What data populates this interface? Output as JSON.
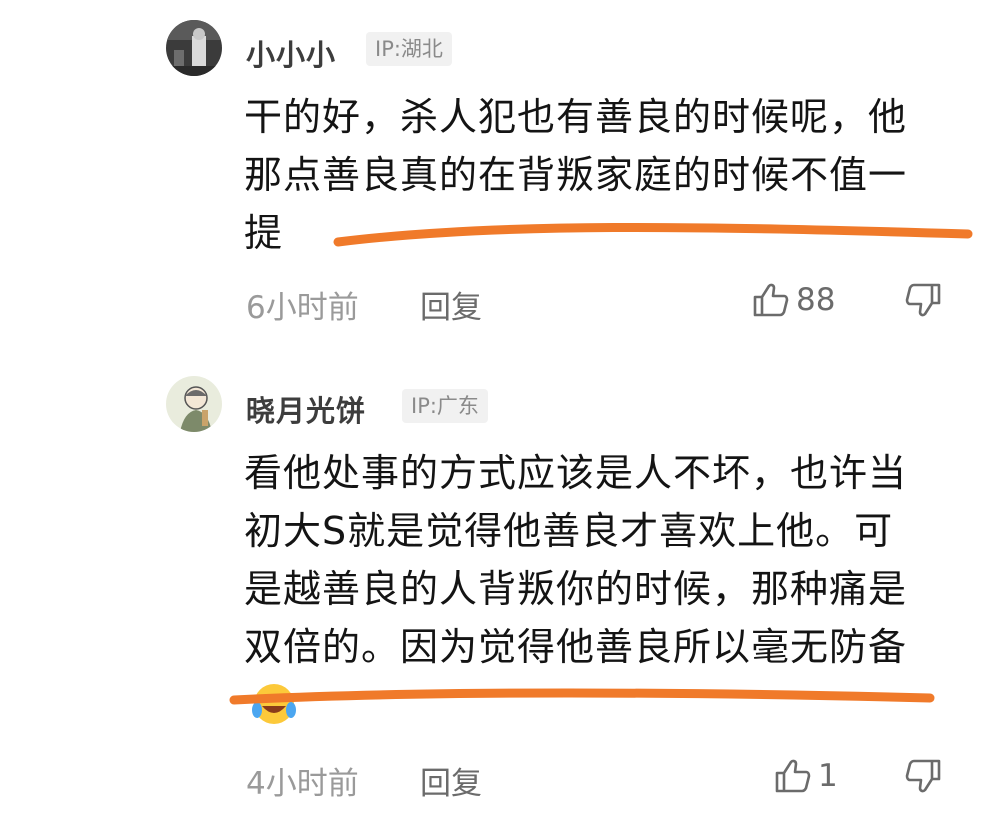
{
  "colors": {
    "highlight": "#f07a2a",
    "meta": "#9a9a9a",
    "badge_bg": "#f1f1f1"
  },
  "comments": [
    {
      "username": "小小小",
      "ip": "IP:湖北",
      "lines": [
        "干的好，杀人犯也有善良的时候呢，他",
        "那点善良真的在背叛家庭的时候不值一",
        "提"
      ],
      "time": "6小时前",
      "reply_label": "回复",
      "likes": "88",
      "avatar_icon": "user-avatar-photo"
    },
    {
      "username": "晓月光饼",
      "ip": "IP:广东",
      "lines": [
        "看他处事的方式应该是人不坏，也许当",
        "初大S就是觉得他善良才喜欢上他。可",
        "是越善良的人背叛你的时候，那种痛是",
        "双倍的。因为觉得他善良所以毫无防备"
      ],
      "emoji": "laughing-tears-emoji",
      "time": "4小时前",
      "reply_label": "回复",
      "likes": "1",
      "avatar_icon": "user-avatar-illustration"
    }
  ]
}
